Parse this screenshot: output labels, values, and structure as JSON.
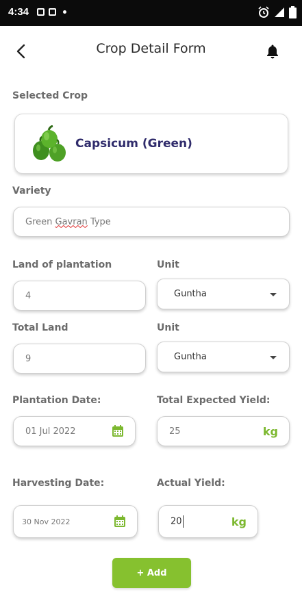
{
  "status_bar": {
    "time": "4:34",
    "icons": [
      "notification-icon",
      "notification-icon",
      "dot-icon",
      "alarm-icon",
      "signal-icon",
      "battery-icon"
    ]
  },
  "header": {
    "title": "Crop Detail Form",
    "back_icon": "back-arrow-icon",
    "bell_icon": "bell-icon"
  },
  "form": {
    "selected_crop_label": "Selected Crop",
    "crop_name": "Capsicum (Green)",
    "variety_label": "Variety",
    "variety_value_before": "Green ",
    "variety_value_misspelled": "Gavran",
    "variety_value_after": " Type",
    "land_of_plantation_label": "Land of plantation",
    "land_of_plantation_value": "4",
    "unit_label_1": "Unit",
    "unit_value_1": "Guntha",
    "total_land_label": "Total Land",
    "total_land_value": "9",
    "unit_label_2": "Unit",
    "unit_value_2": "Guntha",
    "plantation_date_label": "Plantation Date:",
    "plantation_date_value": "01 Jul 2022",
    "total_expected_yield_label": "Total Expected Yield:",
    "total_expected_yield_value": "25",
    "total_expected_yield_unit": "kg",
    "harvesting_date_label": "Harvesting Date:",
    "harvesting_date_value": "30 Nov 2022",
    "actual_yield_label": "Actual Yield:",
    "actual_yield_value": "20",
    "actual_yield_unit": "kg",
    "add_button_label": "+ Add"
  },
  "colors": {
    "accent_green": "#86c12f",
    "title_purple": "#2f2b6b",
    "status_bar_bg": "#0b0b0b"
  }
}
